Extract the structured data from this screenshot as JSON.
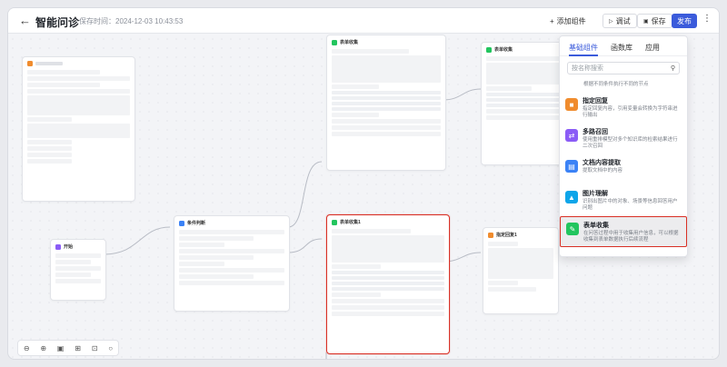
{
  "topbar": {
    "back_icon": "arrow-left-icon",
    "title": "智能问诊",
    "save_time": "保存时间：2024-12-03 10:43:53",
    "add_component_label": "添加组件",
    "debug_label": "调试",
    "save_label": "保存",
    "publish_label": "发布",
    "more_icon": "more-vertical-icon"
  },
  "canvas": {
    "nodes": {
      "start": "开始",
      "condition": "条件判断",
      "form_top": "表单收集",
      "form_sel": "表单收集1",
      "form_right": "表单收集",
      "reply": "指定回复1"
    }
  },
  "panel": {
    "tabs": [
      "基础组件",
      "函数库",
      "应用"
    ],
    "search_placeholder": "按名称搜索",
    "partial_top": "根据不同条件执行不同的节点",
    "components": [
      {
        "name": "指定回复",
        "desc": "指定回复内容，引用变量会转换为字符串进行输出",
        "color": "#f08c2e",
        "icon": "chat-icon"
      },
      {
        "name": "多路召回",
        "desc": "使用重排模型对多个知识库的检索结果进行二次召回",
        "color": "#8b5cf6",
        "icon": "branch-icon"
      },
      {
        "name": "文档内容提取",
        "desc": "提取文档中的内容",
        "color": "#3b82f6",
        "icon": "document-icon"
      },
      {
        "name": "图片理解",
        "desc": "识别出图片中的对象、场景等信息回答用户问题",
        "color": "#0ea5e9",
        "icon": "image-icon"
      },
      {
        "name": "表单收集",
        "desc": "在问答过程中用于收集用户信息，可以根据收集到表单数据执行后续流程",
        "color": "#22c55e",
        "icon": "form-icon"
      }
    ]
  },
  "zoom_icons": [
    "zoom-out-icon",
    "zoom-in-icon",
    "fit-view-icon",
    "layout-icon",
    "collapse-icon",
    "lock-icon"
  ]
}
